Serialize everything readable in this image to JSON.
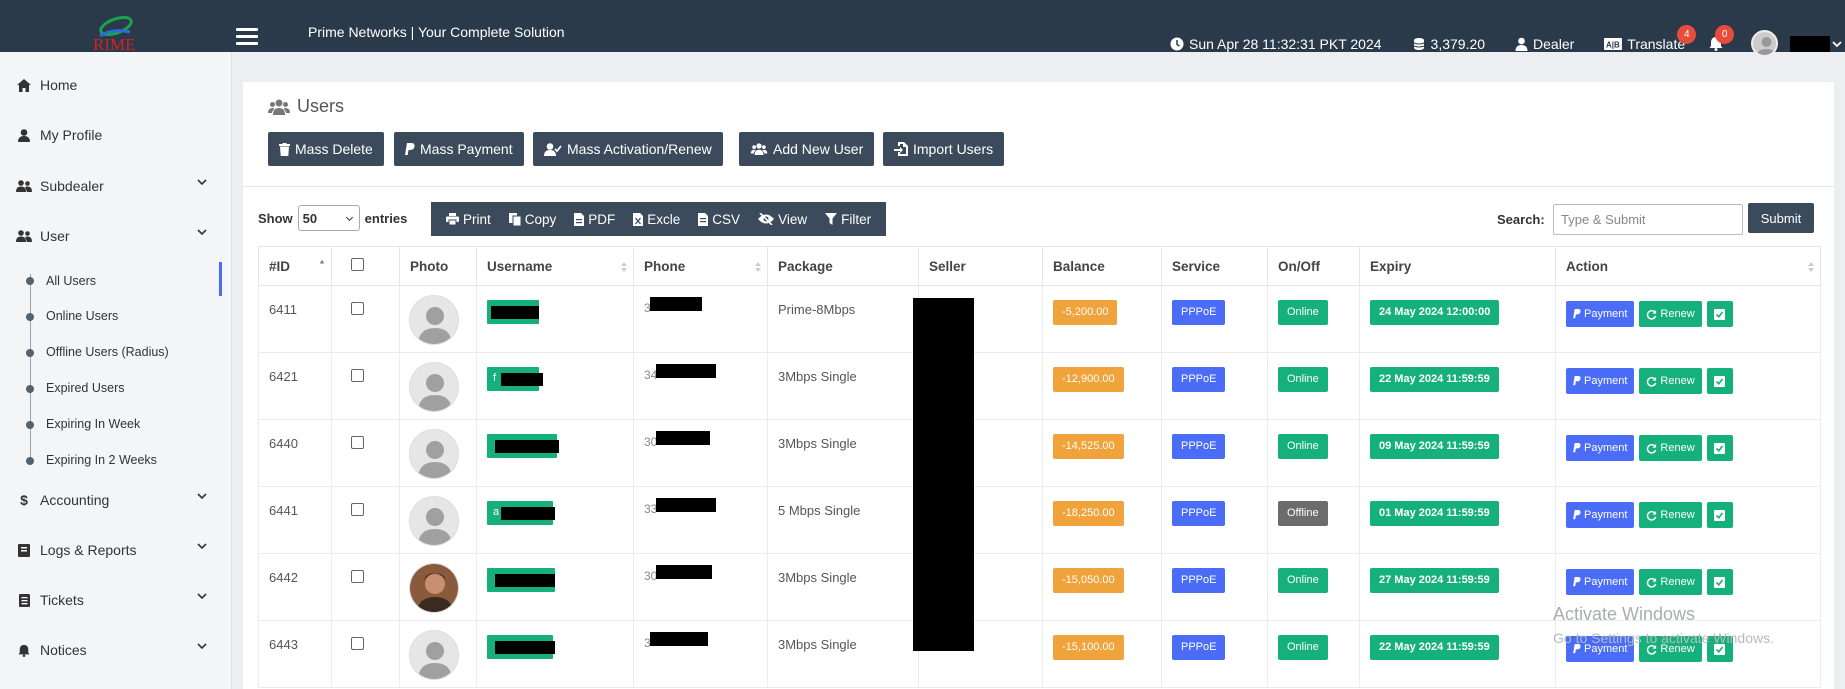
{
  "header": {
    "brand_text": "Prime Networks | Your Complete Solution",
    "datetime": "Sun Apr 28 11:32:31 PKT 2024",
    "balance": "3,379.20",
    "role": "Dealer",
    "translate": "Translate",
    "translate_badge": "4",
    "notif_badge": "0",
    "logo_text": "RIME"
  },
  "sidebar": {
    "items": [
      {
        "label": "Home",
        "icon": "home-icon"
      },
      {
        "label": "My Profile",
        "icon": "user-icon"
      },
      {
        "label": "Subdealer",
        "icon": "users-icon"
      },
      {
        "label": "User",
        "icon": "users-icon"
      },
      {
        "label": "Accounting",
        "icon": "dollar-icon"
      },
      {
        "label": "Logs & Reports",
        "icon": "book-icon"
      },
      {
        "label": "Tickets",
        "icon": "ticket-icon"
      },
      {
        "label": "Notices",
        "icon": "bell-icon"
      }
    ],
    "sub_items": [
      "All Users",
      "Online Users",
      "Offline Users (Radius)",
      "Expired Users",
      "Expiring In Week",
      "Expiring In 2 Weeks"
    ]
  },
  "page": {
    "title": "Users",
    "buttons": {
      "mass_delete": "Mass Delete",
      "mass_payment": "Mass Payment",
      "mass_activation": "Mass Activation/Renew",
      "add_user": "Add New User",
      "import_users": "Import Users"
    },
    "show": "Show",
    "entries": "entries",
    "entries_value": "50",
    "toolbar": [
      "Print",
      "Copy",
      "PDF",
      "Excle",
      "CSV",
      "View",
      "Filter"
    ],
    "search_label": "Search:",
    "search_placeholder": "Type & Submit",
    "submit": "Submit"
  },
  "table": {
    "headers": [
      "#ID",
      "",
      "Photo",
      "Username",
      "Phone",
      "Package",
      "Seller",
      "Balance",
      "Service",
      "On/Off",
      "Expiry",
      "Action"
    ],
    "payment_label": "Payment",
    "renew_label": "Renew",
    "rows": [
      {
        "id": "6411",
        "username_prefix": "",
        "phone_prefix": "3",
        "package": "Prime-8Mbps",
        "balance": "-5,200.00",
        "service": "PPPoE",
        "status": "Online",
        "expiry": "24 May 2024 12:00:00",
        "photo": "default"
      },
      {
        "id": "6421",
        "username_prefix": "f",
        "phone_prefix": "34",
        "package": "3Mbps Single",
        "balance": "-12,900.00",
        "service": "PPPoE",
        "status": "Online",
        "expiry": "22 May 2024 11:59:59",
        "photo": "default"
      },
      {
        "id": "6440",
        "username_prefix": "",
        "phone_prefix": "30",
        "package": "3Mbps Single",
        "balance": "-14,525.00",
        "service": "PPPoE",
        "status": "Online",
        "expiry": "09 May 2024 11:59:59",
        "photo": "default"
      },
      {
        "id": "6441",
        "username_prefix": "a",
        "phone_prefix": "33",
        "package": "5 Mbps Single",
        "balance": "-18,250.00",
        "service": "PPPoE",
        "status": "Offline",
        "expiry": "01 May 2024 11:59:59",
        "photo": "default"
      },
      {
        "id": "6442",
        "username_prefix": "",
        "phone_prefix": "30",
        "package": "3Mbps Single",
        "balance": "-15,050.00",
        "service": "PPPoE",
        "status": "Online",
        "expiry": "27 May 2024 11:59:59",
        "photo": "person"
      },
      {
        "id": "6443",
        "username_prefix": "",
        "phone_prefix": "3",
        "package": "3Mbps Single",
        "balance": "-15,100.00",
        "service": "PPPoE",
        "status": "Online",
        "expiry": "22 May 2024 11:59:59",
        "photo": "default"
      }
    ]
  },
  "watermark": {
    "line1": "Activate Windows",
    "line2": "Go to Settings to activate Windows."
  },
  "colors": {
    "topbar": "#2b3a4a",
    "accent": "#4a6cf7",
    "success": "#16b07d",
    "warning": "#f0a33a"
  }
}
